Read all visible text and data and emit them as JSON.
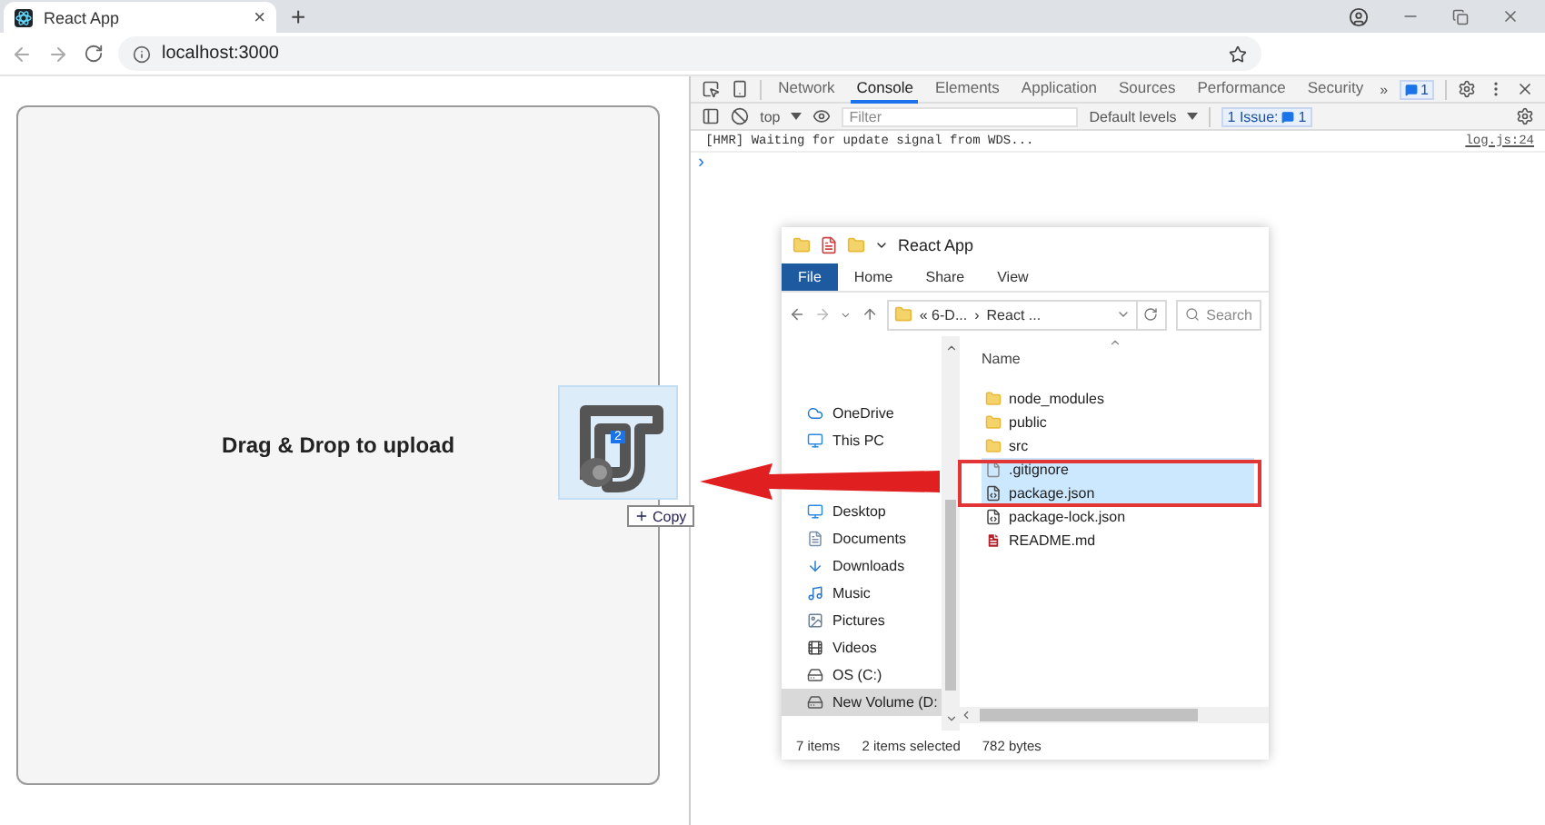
{
  "browser": {
    "tab": {
      "title": "React App",
      "close": "×"
    },
    "new_tab": "+",
    "url": "localhost:3000"
  },
  "page": {
    "drop_zone": {
      "label": "Drag & Drop to upload"
    }
  },
  "devtools": {
    "tabs": [
      {
        "label": "Network",
        "selected": false
      },
      {
        "label": "Console",
        "selected": true
      },
      {
        "label": "Elements",
        "selected": false
      },
      {
        "label": "Application",
        "selected": false
      },
      {
        "label": "Sources",
        "selected": false
      },
      {
        "label": "Performance",
        "selected": false
      },
      {
        "label": "Security",
        "selected": false
      }
    ],
    "more": "»",
    "message_count": "1",
    "context": "top",
    "filter": {
      "placeholder": "Filter"
    },
    "levels": "Default levels",
    "issues": {
      "label": "1 Issue:",
      "count": "1"
    },
    "console": [
      {
        "message": "[HMR] Waiting for update signal from WDS...",
        "source": "log.js:24"
      }
    ],
    "prompt": "›"
  },
  "explorer": {
    "title": "React App",
    "ribbon_tabs": [
      {
        "label": "File",
        "selected": true
      },
      {
        "label": "Home",
        "selected": false
      },
      {
        "label": "Share",
        "selected": false
      },
      {
        "label": "View",
        "selected": false
      }
    ],
    "path": [
      "« 6-D...",
      "›",
      "React ..."
    ],
    "search": {
      "placeholder": "Search"
    },
    "nav": [
      {
        "label": "OneDrive",
        "kind": "cloud",
        "selected": false
      },
      {
        "label": "This PC",
        "kind": "pc",
        "selected": false
      },
      {
        "label": "Desktop",
        "kind": "desktop",
        "selected": false
      },
      {
        "label": "Documents",
        "kind": "document",
        "selected": false
      },
      {
        "label": "Downloads",
        "kind": "download",
        "selected": false
      },
      {
        "label": "Music",
        "kind": "music",
        "selected": false
      },
      {
        "label": "Pictures",
        "kind": "pictures",
        "selected": false
      },
      {
        "label": "Videos",
        "kind": "video",
        "selected": false
      },
      {
        "label": "OS (C:)",
        "kind": "drive",
        "selected": false
      },
      {
        "label": "New Volume (D:",
        "kind": "drive",
        "selected": true
      }
    ],
    "column": "Name",
    "files": [
      {
        "name": "node_modules",
        "kind": "folder",
        "selected": false
      },
      {
        "name": "public",
        "kind": "folder",
        "selected": false
      },
      {
        "name": "src",
        "kind": "folder",
        "selected": false
      },
      {
        "name": ".gitignore",
        "kind": "text",
        "selected": true
      },
      {
        "name": "package.json",
        "kind": "json",
        "selected": true
      },
      {
        "name": "package-lock.json",
        "kind": "json",
        "selected": false
      },
      {
        "name": "README.md",
        "kind": "pdf",
        "selected": false
      }
    ],
    "status": {
      "count": "7 items",
      "selection": "2 items selected",
      "size": "782 bytes"
    }
  },
  "drag": {
    "count": "2",
    "effect": "Copy"
  }
}
